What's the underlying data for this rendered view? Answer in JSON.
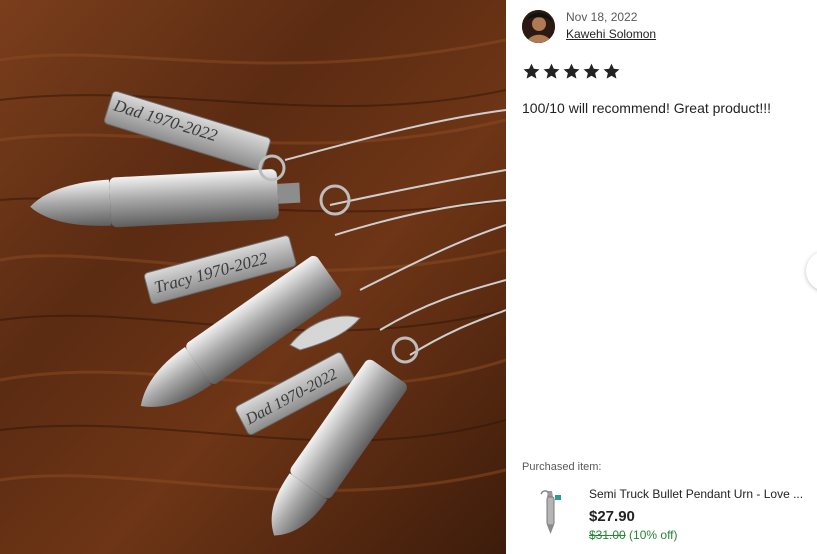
{
  "review": {
    "date": "Nov 18, 2022",
    "reviewer_name": "Kawehi Solomon",
    "rating": 5,
    "rating_max": 5,
    "text": "100/10 will recommend! Great product!!!"
  },
  "photo": {
    "engravings": [
      "Dad 1970-2022",
      "Tracy 1970-2022",
      "Dad 1970-2022"
    ]
  },
  "purchased": {
    "label": "Purchased item:",
    "title": "Semi Truck Bullet Pendant Urn - Love ...",
    "price": "$27.90",
    "original_price": "$31.00",
    "discount": "(10% off)"
  },
  "colors": {
    "star": "#222222",
    "sale_green": "#258635",
    "link": "#222222"
  },
  "icons": {
    "star": "star-icon",
    "next": "chevron-right-icon"
  }
}
